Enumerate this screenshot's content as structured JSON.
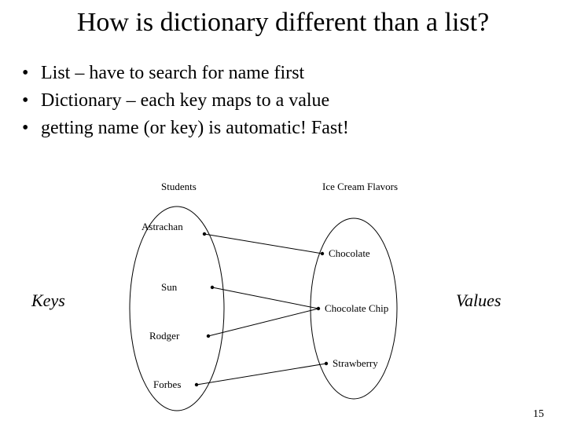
{
  "title": "How is dictionary different than a list?",
  "bullets": [
    "List – have to search for name first",
    "Dictionary – each key maps to a value",
    "getting name (or key)  is automatic! Fast!"
  ],
  "side_labels": {
    "keys": "Keys",
    "values": "Values"
  },
  "diagram": {
    "left_header": "Students",
    "right_header": "Ice Cream Flavors",
    "left_nodes": [
      "Astrachan",
      "Sun",
      "Rodger",
      "Forbes"
    ],
    "right_nodes": [
      "Chocolate",
      "Chocolate Chip",
      "Strawberry"
    ],
    "edges": [
      [
        0,
        0
      ],
      [
        1,
        1
      ],
      [
        2,
        1
      ],
      [
        3,
        2
      ]
    ]
  },
  "page_number": "15"
}
